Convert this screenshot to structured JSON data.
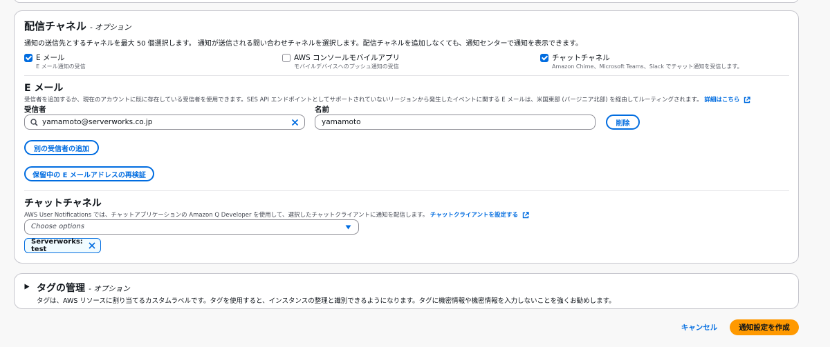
{
  "delivery": {
    "title": "配信チャネル",
    "optional": "- オプション",
    "description": "通知の送信先とするチャネルを最大 50 個選択します。 通知が送信される問い合わせチャネルを選択します。配信チャネルを追加しなくても、通知センターで通知を表示できます。",
    "channels": [
      {
        "label": "E メール",
        "sub": "E メール通知の受信",
        "checked": true
      },
      {
        "label": "AWS コンソールモバイルアプリ",
        "sub": "モバイルデバイスへのプッシュ通知の受信",
        "checked": false
      },
      {
        "label": "チャットチャネル",
        "sub": "Amazon Chime、Microsoft Teams、Slack でチャット通知を受信します。",
        "checked": true
      }
    ]
  },
  "email": {
    "title": "E メール",
    "description": "受信者を追加するか、現在のアカウントに既に存在している受信者を使用できます。SES API エンドポイントとしてサポートされていないリージョンから発生したイベントに関する E メールは、米国東部 (バージニア北部) を経由してルーティングされます。",
    "details_link": "詳細はこちら",
    "recipient_label": "受信者",
    "name_label": "名前",
    "recipient_value": "yamamoto@serverworks.co.jp",
    "name_value": "yamamoto",
    "delete_label": "削除",
    "add_recipient_label": "別の受信者の追加",
    "reverify_label": "保留中の E メールアドレスの再検証"
  },
  "chat": {
    "title": "チャットチャネル",
    "description": "AWS User Notifications では、チャットアプリケーションの Amazon Q Developer を使用して、選択したチャットクライアントに通知を配信します。",
    "configure_link": "チャットクライアントを設定する",
    "select_placeholder": "Choose options",
    "token_label": "Serverworks: test"
  },
  "tags": {
    "title": "タグの管理",
    "optional": "- オプション",
    "description": "タグは、AWS リソースに割り当てるカスタムラベルです。タグを使用すると、インスタンスの整理と識別できるようになります。タグに機密情報や機密情報を入力しないことを強くお勧めします。"
  },
  "footer": {
    "cancel_label": "キャンセル",
    "create_label": "通知設定を作成"
  },
  "colors": {
    "accent": "#006ce0",
    "primary_button": "#ff9900",
    "border": "#c6c6cd"
  },
  "icons": [
    "checkbox-checked-icon",
    "search-icon",
    "clear-x-icon",
    "external-link-icon",
    "caret-down-icon",
    "caret-right-icon",
    "dismiss-x-icon"
  ]
}
